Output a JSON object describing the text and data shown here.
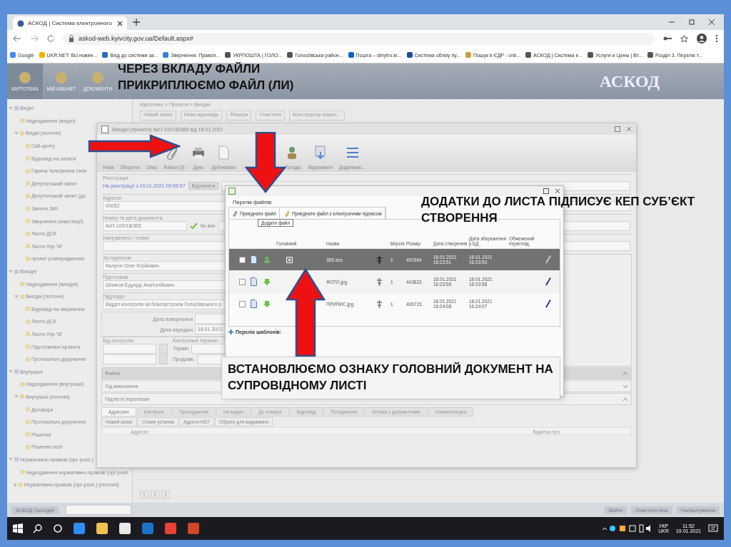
{
  "browser": {
    "tab_title": "АСКОД | Система електронного",
    "url": "askod-web.kyivcity.gov.ua/Default.aspx#",
    "bookmarks": [
      "Google",
      "UKR.NET: Всі новин...",
      "Вхід до системи за...",
      "Звернення. Правоп...",
      "УКРПОШТА | ГОЛО...",
      "Голосіївська район...",
      "Пошта – dmytro.kr...",
      "Система обліку пу...",
      "Пошук в ЄДР - onli...",
      "АСКОД | Система е...",
      "Услуги и Цены | Вт...",
      "Розділ 3. Перелік т..."
    ]
  },
  "app_header": {
    "nav": [
      {
        "label": "КАРТОТЕКА",
        "selected": true
      },
      {
        "label": "МІЙ КАБІНЕТ",
        "selected": false
      },
      {
        "label": "ДОКУМЕНТИ",
        "selected": false
      }
    ],
    "logo": "АСКОД"
  },
  "tree": [
    {
      "label": "Вхідні",
      "expanded": true,
      "children": [
        {
          "label": "Надходження (вхідні)"
        },
        {
          "label": "Вхідні (поточні)",
          "expanded": true,
          "children": [
            {
              "label": "Call-центр"
            },
            {
              "label": "Відповіді на запити"
            },
            {
              "label": "Гаряча телефонна лінія"
            },
            {
              "label": "Депутатський запит"
            },
            {
              "label": "Депутатський запит (до"
            },
            {
              "label": "Запити ЗМІ"
            },
            {
              "label": "Звернення (інвестиції)"
            },
            {
              "label": "Листи ДСК"
            },
            {
              "label": "Листи Упр 'М'"
            },
            {
              "label": "проект розпорядження"
            }
          ]
        }
      ]
    },
    {
      "label": "Вихідні",
      "expanded": true,
      "children": [
        {
          "label": "Надходження (вихідні)"
        },
        {
          "label": "Вихідні (поточні)",
          "expanded": true,
          "children": [
            {
              "label": "Відповіді на звернення"
            },
            {
              "label": "Листи ДСК"
            },
            {
              "label": "Листи Упр 'М'"
            },
            {
              "label": "Підготовлені проекти"
            },
            {
              "label": "Протокольні доручення"
            }
          ]
        }
      ]
    },
    {
      "label": "Внутрішні",
      "expanded": true,
      "children": [
        {
          "label": "Надходження (внутрішні)"
        },
        {
          "label": "Внутрішні (поточні)",
          "expanded": true,
          "children": [
            {
              "label": "Договори"
            },
            {
              "label": "Протокольні доручення"
            },
            {
              "label": "Рішення"
            },
            {
              "label": "Рішення сесії"
            }
          ]
        }
      ]
    },
    {
      "label": "Нормативно-правові (орг-розп.)",
      "expanded": true,
      "children": [
        {
          "label": "Надходження нормативно-правові (орг-розп."
        },
        {
          "label": "Нормативно-правові (орг-розп.) (поточні)",
          "expanded": false
        }
      ]
    }
  ],
  "list_panel": {
    "breadcrumb": "Картотека > Проекти > Вихідні",
    "toolbar": [
      "Новий запис",
      "Нова відповідь",
      "Фільтри",
      "Очистити",
      "Конструктор візуал..."
    ],
    "pager": [
      "1",
      "2",
      "3"
    ]
  },
  "document_window": {
    "title": "Вихідні (проекти) №П-100/18/365 від 18.01.2021",
    "toolbar": [
      {
        "label": "Нова"
      },
      {
        "label": "Зберегти"
      },
      {
        "label": "Опис"
      },
      {
        "label": "Файли (3)",
        "kind": "paperclip"
      },
      {
        "label": "Друк",
        "kind": "printer"
      },
      {
        "label": "Дублювати",
        "kind": "page"
      },
      {
        "label": "Погодж.",
        "kind": "people"
      },
      {
        "label": "Відправити",
        "kind": "send"
      },
      {
        "label": "Додатково...",
        "kind": "menu"
      }
    ],
    "registration": {
      "legend": "Реєстрація",
      "status": "На реєстрації з 19.01.2021 09:56:57",
      "reject_button": "Відхилити"
    },
    "fields": [
      {
        "label": "Адресат",
        "value": "00052"
      },
      {
        "label": "Номер та дата документа",
        "value": "№П-100/18/365",
        "extra": "№ вих"
      },
      {
        "label": "Направлено / стамп"
      }
    ],
    "signers": [
      {
        "label": "За підписом",
        "value": "Калугін Олег Юрійович"
      },
      {
        "label": "Підготував",
        "value": "Шпиков Едуард Анатолійович"
      },
      {
        "label": "Підрозділ",
        "value": "Відділ контролю за благоустроєм Голосіївського р"
      }
    ],
    "dates": [
      {
        "label": "Дата повернення"
      },
      {
        "label": "Дата передачі",
        "value": "18.01.2021"
      }
    ],
    "control": {
      "legend": "Від контролю",
      "terms_legend": "Контрольні терміни",
      "term": "Термін",
      "extend": "Продовж."
    },
    "sections": [
      {
        "label": "Файли",
        "expanded": true
      },
      {
        "label": "Хід виконання",
        "expanded": false
      },
      {
        "label": "Підлеглі переписки",
        "expanded": true
      }
    ],
    "tabs": [
      {
        "label": "Адресати",
        "selected": true
      },
      {
        "label": "Контроль",
        "selected": false
      },
      {
        "label": "Проходження",
        "selected": false
      },
      {
        "label": "На видан",
        "selected": false
      },
      {
        "label": "До номера",
        "selected": false
      },
      {
        "label": "Відповіді",
        "selected": false
      },
      {
        "label": "Погодження",
        "selected": false
      },
      {
        "label": "Зв'язок з документами",
        "selected": false
      },
      {
        "label": "Номенклатура",
        "selected": false
      }
    ],
    "tab_buttons": [
      "Новий запис",
      "Схеми установ",
      "Адреси НБУ",
      "Обрати для видавання"
    ],
    "columns": [
      "Адресат",
      "Відмітка про"
    ]
  },
  "files_dialog": {
    "list_label": "Перелік файлів:",
    "buttons": [
      "Приєднати файл",
      "Приєднати файл з електронним підписом"
    ],
    "tooltip": "Додати файл",
    "columns": [
      "Головний",
      "Назва",
      "Версія",
      "Розмір",
      "Дата створення",
      "Дата збереження у БД",
      "Обмежений перегляд"
    ],
    "rows": [
      {
        "selected": true,
        "main": true,
        "name": "365.doc",
        "version": "1",
        "size": "497664",
        "created": "18.01.2021 16:23:51",
        "saved": "18.01.2021 16:23:50"
      },
      {
        "selected": false,
        "name": "ФОТО.jpg",
        "version": "1",
        "size": "443823",
        "created": "18.01.2021 16:23:59",
        "saved": "18.01.2021 16:23:58"
      },
      {
        "selected": false,
        "name": "ПРИПИС.jpg",
        "version": "1",
        "size": "406715",
        "created": "18.01.2021 16:24:08",
        "saved": "18.01.2021 16:24:07"
      }
    ],
    "templates_label": "Перелік шаблонів:"
  },
  "status_bar": {
    "left": "АСКОД Сьогодні",
    "right": [
      "Вийти",
      "Очистити кеш",
      "Налаштування"
    ]
  },
  "taskbar": {
    "lang": "УКР",
    "lang2": "UKR",
    "time": "11:52",
    "date": "19.01.2021"
  },
  "annotations": [
    {
      "text": "ЧЕРЕЗ ВКЛАДУ ФАЙЛИ ПРИКРИПЛЮЄМО ФАЙЛ (ЛИ)",
      "boxed": false
    },
    {
      "text": "ДОДАТКИ ДО ЛИСТА ПІДПИСУЄ КЕП СУБ’ЄКТ СТВОРЕННЯ",
      "boxed": false
    },
    {
      "text": "ВСТАНОВЛЮЄМО ОЗНАКУ ГОЛОВНИЙ ДОКУМЕНТ НА СУПРОВІДНОМУ ЛИСТІ",
      "boxed": true
    }
  ]
}
